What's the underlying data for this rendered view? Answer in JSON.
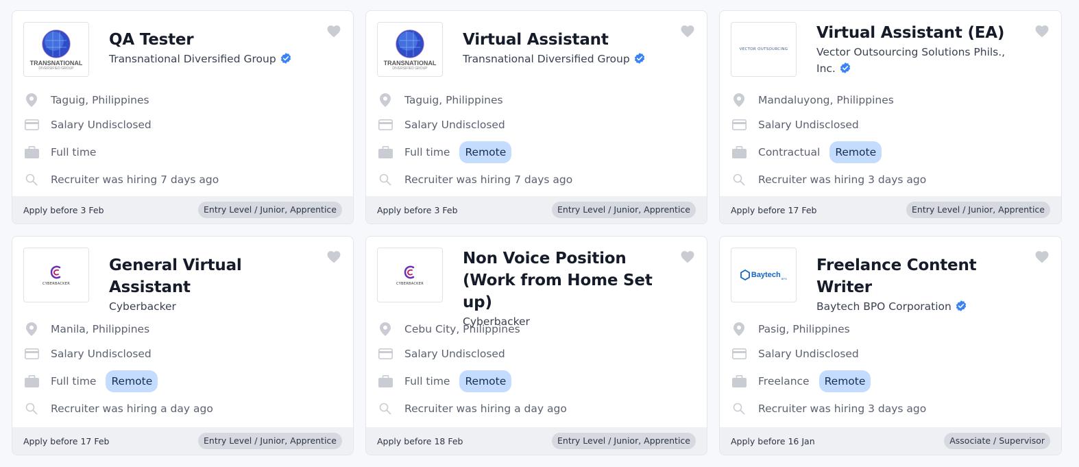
{
  "cards": [
    {
      "title": "QA Tester",
      "company": "Transnational Diversified Group",
      "verified": true,
      "logo": "transnational",
      "location": "Taguig, Philippines",
      "salary": "Salary Undisclosed",
      "type": "Full time",
      "remote": "",
      "hiring": "Recruiter was hiring 7 days ago",
      "apply": "Apply before 3 Feb",
      "level": "Entry Level / Junior, Apprentice"
    },
    {
      "title": "Virtual Assistant",
      "company": "Transnational Diversified Group",
      "verified": true,
      "logo": "transnational",
      "location": "Taguig, Philippines",
      "salary": "Salary Undisclosed",
      "type": "Full time",
      "remote": "Remote",
      "hiring": "Recruiter was hiring 7 days ago",
      "apply": "Apply before 3 Feb",
      "level": "Entry Level / Junior, Apprentice"
    },
    {
      "title": "Virtual Assistant (EA)",
      "company": "Vector Outsourcing Solutions Phils., Inc.",
      "verified": true,
      "logo": "vector",
      "location": "Mandaluyong, Philippines",
      "salary": "Salary Undisclosed",
      "type": "Contractual",
      "remote": "Remote",
      "hiring": "Recruiter was hiring 3 days ago",
      "apply": "Apply before 17 Feb",
      "level": "Entry Level / Junior, Apprentice"
    },
    {
      "title": "General Virtual Assistant",
      "company": "Cyberbacker",
      "verified": false,
      "logo": "cyberbacker",
      "location": "Manila, Philippines",
      "salary": "Salary Undisclosed",
      "type": "Full time",
      "remote": "Remote",
      "hiring": "Recruiter was hiring a day ago",
      "apply": "Apply before 17 Feb",
      "level": "Entry Level / Junior, Apprentice"
    },
    {
      "title": "Non Voice Position (Work from Home Set up)",
      "company": "Cyberbacker",
      "verified": false,
      "logo": "cyberbacker",
      "location": "Cebu City, Philippines",
      "salary": "Salary Undisclosed",
      "type": "Full time",
      "remote": "Remote",
      "hiring": "Recruiter was hiring a day ago",
      "apply": "Apply before 18 Feb",
      "level": "Entry Level / Junior, Apprentice"
    },
    {
      "title": "Freelance Content Writer",
      "company": "Baytech BPO Corporation",
      "verified": true,
      "logo": "baytech",
      "location": "Pasig, Philippines",
      "salary": "Salary Undisclosed",
      "type": "Freelance",
      "remote": "Remote",
      "hiring": "Recruiter was hiring 3 days ago",
      "apply": "Apply before 16 Jan",
      "level": "Associate / Supervisor"
    }
  ],
  "logos": {
    "transnational": {
      "word": "TRANSNATIONAL",
      "sub": "DIVERSIFIED GROUP"
    },
    "vector": {
      "word": "VECTOR OUTSOURCING"
    },
    "cyberbacker": {
      "word": "CYBERBACKER"
    },
    "baytech": {
      "word": "Baytech",
      "sub": "BPO"
    }
  },
  "colors": {
    "remote_bg": "#c4dcff",
    "verified": "#3b82f6",
    "icon": "#c9ccd3",
    "footer_bg": "#eef0f4"
  }
}
